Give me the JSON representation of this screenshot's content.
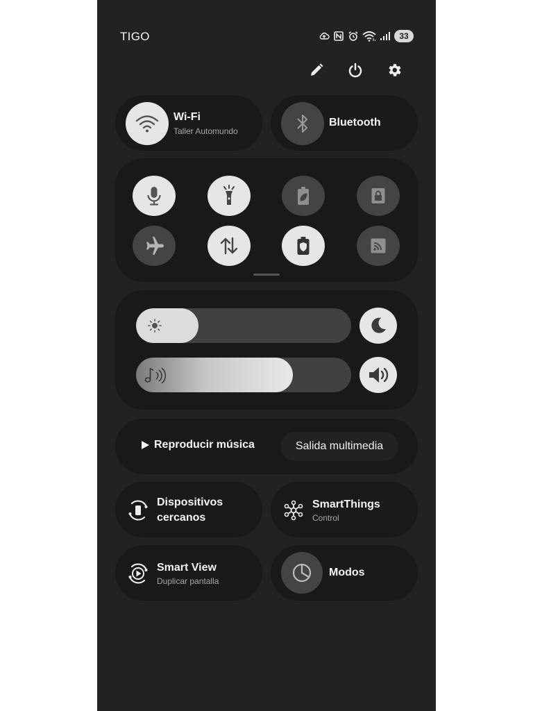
{
  "status": {
    "carrier": "TIGO",
    "battery": "33"
  },
  "top_actions": {
    "icons": [
      "pencil-icon",
      "power-icon",
      "gear-icon"
    ]
  },
  "wifi": {
    "title": "Wi-Fi",
    "network": "Taller Automundo",
    "state": "on"
  },
  "bluetooth": {
    "title": "Bluetooth",
    "state": "off"
  },
  "quick_settings": [
    {
      "name": "microphone-icon",
      "state": "on"
    },
    {
      "name": "flashlight-icon",
      "state": "on"
    },
    {
      "name": "power-saving-icon",
      "state": "off"
    },
    {
      "name": "secure-folder-icon",
      "state": "off"
    },
    {
      "name": "airplane-icon",
      "state": "off"
    },
    {
      "name": "mobile-data-icon",
      "state": "on"
    },
    {
      "name": "battery-protect-icon",
      "state": "on"
    },
    {
      "name": "cast-icon",
      "state": "off"
    }
  ],
  "sliders": {
    "brightness_level": 0.29,
    "volume_level": 0.73
  },
  "media": {
    "play_label": "Reproducir música",
    "output_label": "Salida multimedia"
  },
  "tiles": {
    "nearby": {
      "title_line1": "Dispositivos",
      "title_line2": "cercanos"
    },
    "smartthings": {
      "title": "SmartThings",
      "subtitle": "Control"
    },
    "smartview": {
      "title": "Smart View",
      "subtitle": "Duplicar pantalla"
    },
    "modes": {
      "title": "Modos"
    }
  },
  "colors": {
    "panel_bg": "#222222",
    "card_bg": "#191919",
    "toggle_on": "#e6e6e6",
    "toggle_off": "#444444"
  }
}
